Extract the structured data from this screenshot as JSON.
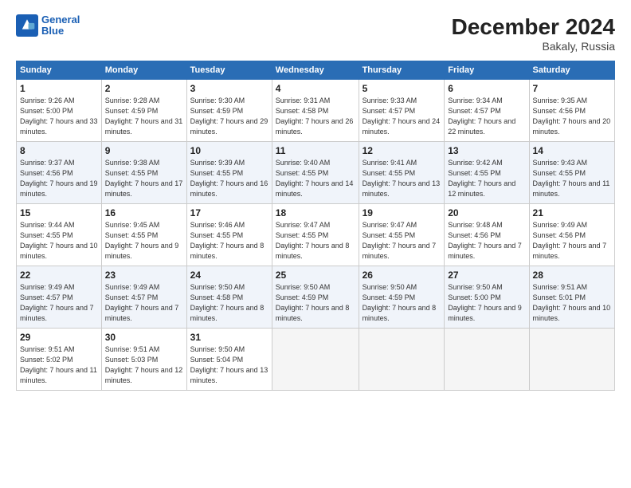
{
  "header": {
    "logo_line1": "General",
    "logo_line2": "Blue",
    "title": "December 2024",
    "location": "Bakaly, Russia"
  },
  "days_of_week": [
    "Sunday",
    "Monday",
    "Tuesday",
    "Wednesday",
    "Thursday",
    "Friday",
    "Saturday"
  ],
  "weeks": [
    [
      {
        "day": "1",
        "sunrise": "Sunrise: 9:26 AM",
        "sunset": "Sunset: 5:00 PM",
        "daylight": "Daylight: 7 hours and 33 minutes."
      },
      {
        "day": "2",
        "sunrise": "Sunrise: 9:28 AM",
        "sunset": "Sunset: 4:59 PM",
        "daylight": "Daylight: 7 hours and 31 minutes."
      },
      {
        "day": "3",
        "sunrise": "Sunrise: 9:30 AM",
        "sunset": "Sunset: 4:59 PM",
        "daylight": "Daylight: 7 hours and 29 minutes."
      },
      {
        "day": "4",
        "sunrise": "Sunrise: 9:31 AM",
        "sunset": "Sunset: 4:58 PM",
        "daylight": "Daylight: 7 hours and 26 minutes."
      },
      {
        "day": "5",
        "sunrise": "Sunrise: 9:33 AM",
        "sunset": "Sunset: 4:57 PM",
        "daylight": "Daylight: 7 hours and 24 minutes."
      },
      {
        "day": "6",
        "sunrise": "Sunrise: 9:34 AM",
        "sunset": "Sunset: 4:57 PM",
        "daylight": "Daylight: 7 hours and 22 minutes."
      },
      {
        "day": "7",
        "sunrise": "Sunrise: 9:35 AM",
        "sunset": "Sunset: 4:56 PM",
        "daylight": "Daylight: 7 hours and 20 minutes."
      }
    ],
    [
      {
        "day": "8",
        "sunrise": "Sunrise: 9:37 AM",
        "sunset": "Sunset: 4:56 PM",
        "daylight": "Daylight: 7 hours and 19 minutes."
      },
      {
        "day": "9",
        "sunrise": "Sunrise: 9:38 AM",
        "sunset": "Sunset: 4:55 PM",
        "daylight": "Daylight: 7 hours and 17 minutes."
      },
      {
        "day": "10",
        "sunrise": "Sunrise: 9:39 AM",
        "sunset": "Sunset: 4:55 PM",
        "daylight": "Daylight: 7 hours and 16 minutes."
      },
      {
        "day": "11",
        "sunrise": "Sunrise: 9:40 AM",
        "sunset": "Sunset: 4:55 PM",
        "daylight": "Daylight: 7 hours and 14 minutes."
      },
      {
        "day": "12",
        "sunrise": "Sunrise: 9:41 AM",
        "sunset": "Sunset: 4:55 PM",
        "daylight": "Daylight: 7 hours and 13 minutes."
      },
      {
        "day": "13",
        "sunrise": "Sunrise: 9:42 AM",
        "sunset": "Sunset: 4:55 PM",
        "daylight": "Daylight: 7 hours and 12 minutes."
      },
      {
        "day": "14",
        "sunrise": "Sunrise: 9:43 AM",
        "sunset": "Sunset: 4:55 PM",
        "daylight": "Daylight: 7 hours and 11 minutes."
      }
    ],
    [
      {
        "day": "15",
        "sunrise": "Sunrise: 9:44 AM",
        "sunset": "Sunset: 4:55 PM",
        "daylight": "Daylight: 7 hours and 10 minutes."
      },
      {
        "day": "16",
        "sunrise": "Sunrise: 9:45 AM",
        "sunset": "Sunset: 4:55 PM",
        "daylight": "Daylight: 7 hours and 9 minutes."
      },
      {
        "day": "17",
        "sunrise": "Sunrise: 9:46 AM",
        "sunset": "Sunset: 4:55 PM",
        "daylight": "Daylight: 7 hours and 8 minutes."
      },
      {
        "day": "18",
        "sunrise": "Sunrise: 9:47 AM",
        "sunset": "Sunset: 4:55 PM",
        "daylight": "Daylight: 7 hours and 8 minutes."
      },
      {
        "day": "19",
        "sunrise": "Sunrise: 9:47 AM",
        "sunset": "Sunset: 4:55 PM",
        "daylight": "Daylight: 7 hours and 7 minutes."
      },
      {
        "day": "20",
        "sunrise": "Sunrise: 9:48 AM",
        "sunset": "Sunset: 4:56 PM",
        "daylight": "Daylight: 7 hours and 7 minutes."
      },
      {
        "day": "21",
        "sunrise": "Sunrise: 9:49 AM",
        "sunset": "Sunset: 4:56 PM",
        "daylight": "Daylight: 7 hours and 7 minutes."
      }
    ],
    [
      {
        "day": "22",
        "sunrise": "Sunrise: 9:49 AM",
        "sunset": "Sunset: 4:57 PM",
        "daylight": "Daylight: 7 hours and 7 minutes."
      },
      {
        "day": "23",
        "sunrise": "Sunrise: 9:49 AM",
        "sunset": "Sunset: 4:57 PM",
        "daylight": "Daylight: 7 hours and 7 minutes."
      },
      {
        "day": "24",
        "sunrise": "Sunrise: 9:50 AM",
        "sunset": "Sunset: 4:58 PM",
        "daylight": "Daylight: 7 hours and 8 minutes."
      },
      {
        "day": "25",
        "sunrise": "Sunrise: 9:50 AM",
        "sunset": "Sunset: 4:59 PM",
        "daylight": "Daylight: 7 hours and 8 minutes."
      },
      {
        "day": "26",
        "sunrise": "Sunrise: 9:50 AM",
        "sunset": "Sunset: 4:59 PM",
        "daylight": "Daylight: 7 hours and 8 minutes."
      },
      {
        "day": "27",
        "sunrise": "Sunrise: 9:50 AM",
        "sunset": "Sunset: 5:00 PM",
        "daylight": "Daylight: 7 hours and 9 minutes."
      },
      {
        "day": "28",
        "sunrise": "Sunrise: 9:51 AM",
        "sunset": "Sunset: 5:01 PM",
        "daylight": "Daylight: 7 hours and 10 minutes."
      }
    ],
    [
      {
        "day": "29",
        "sunrise": "Sunrise: 9:51 AM",
        "sunset": "Sunset: 5:02 PM",
        "daylight": "Daylight: 7 hours and 11 minutes."
      },
      {
        "day": "30",
        "sunrise": "Sunrise: 9:51 AM",
        "sunset": "Sunset: 5:03 PM",
        "daylight": "Daylight: 7 hours and 12 minutes."
      },
      {
        "day": "31",
        "sunrise": "Sunrise: 9:50 AM",
        "sunset": "Sunset: 5:04 PM",
        "daylight": "Daylight: 7 hours and 13 minutes."
      },
      null,
      null,
      null,
      null
    ]
  ]
}
